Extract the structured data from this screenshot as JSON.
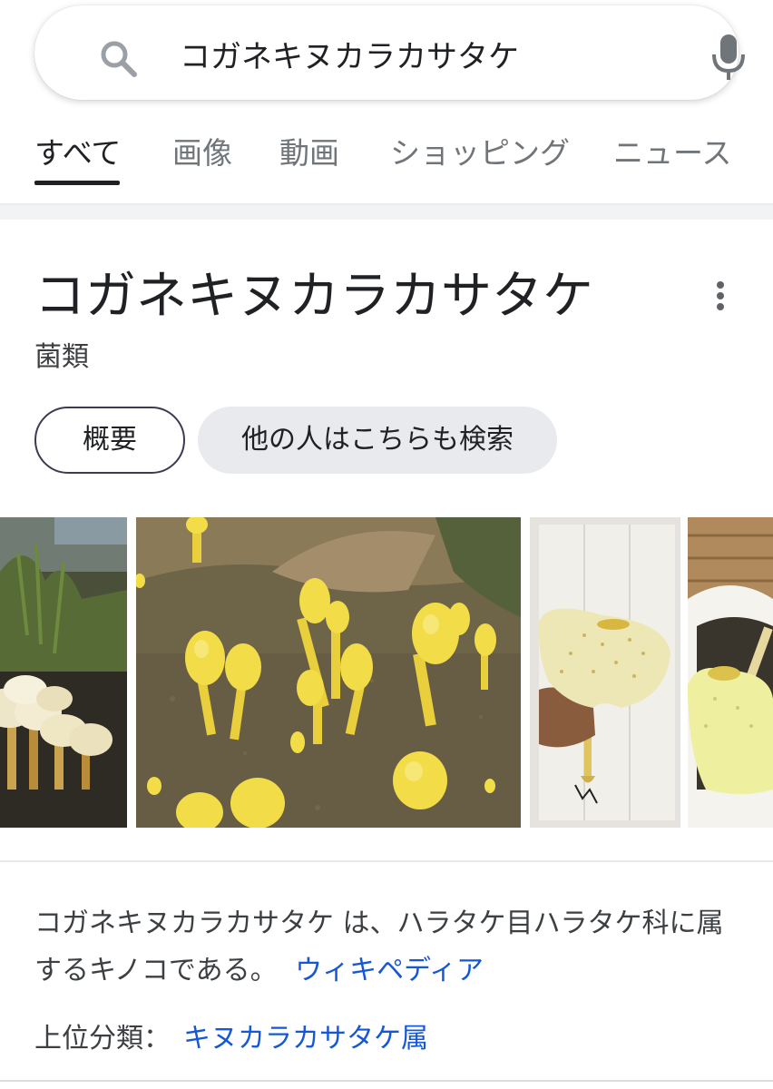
{
  "search": {
    "query": "コガネキヌカラカサタケ"
  },
  "tabs": [
    {
      "label": "すべて",
      "active": true
    },
    {
      "label": "画像",
      "active": false
    },
    {
      "label": "動画",
      "active": false
    },
    {
      "label": "ショッピング",
      "active": false
    },
    {
      "label": "ニュース",
      "active": false
    }
  ],
  "knowledge_panel": {
    "title": "コガネキヌカラカサタケ",
    "subtitle": "菌類",
    "chips": [
      "概要",
      "他の人はこちらも検索"
    ],
    "description": "コガネキヌカラカサタケ は、ハラタケ目ハラタケ科に属するキノコである。",
    "source_link": "ウィキペディア",
    "taxon_label": "上位分類：",
    "taxon_value": "キヌカラカサタケ属"
  },
  "images": [
    {
      "name": "mushroom-cluster-image"
    },
    {
      "name": "yellow-mushrooms-soil-image"
    },
    {
      "name": "mushroom-in-hand-image"
    },
    {
      "name": "mushroom-in-pot-image"
    }
  ],
  "icons": [
    "search-icon",
    "mic-icon",
    "more-vert-icon"
  ],
  "colors": {
    "link": "#1558d6",
    "mushroom_yellow": "#f2dd48",
    "chip_bg": "#e8eaed"
  }
}
